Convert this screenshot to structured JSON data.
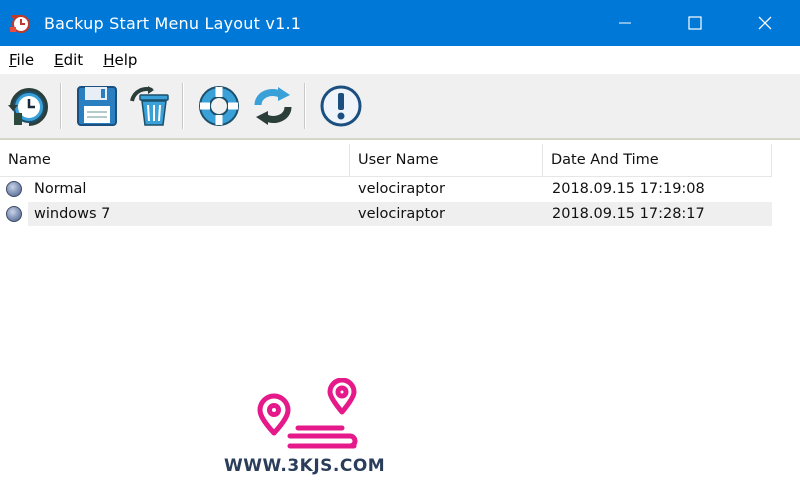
{
  "window": {
    "title": "Backup Start Menu Layout v1.1",
    "titlebar_color": "#0078d7"
  },
  "menu": {
    "items": [
      {
        "accel": "F",
        "rest": "ile"
      },
      {
        "accel": "E",
        "rest": "dit"
      },
      {
        "accel": "H",
        "rest": "elp"
      }
    ]
  },
  "toolbar": {
    "buttons": [
      "backup-clock-icon",
      "save-icon",
      "recycle-bin-icon",
      "lifebuoy-icon",
      "refresh-icon",
      "info-icon"
    ]
  },
  "list": {
    "columns": [
      "Name",
      "User Name",
      "Date And Time"
    ],
    "rows": [
      {
        "name": "Normal",
        "user": "velociraptor",
        "datetime": "2018.09.15 17:19:08"
      },
      {
        "name": "windows 7",
        "user": "velociraptor",
        "datetime": "2018.09.15 17:28:17"
      }
    ]
  },
  "watermark": {
    "text": "WWW.3KJS.COM",
    "color": "#e5198a"
  }
}
